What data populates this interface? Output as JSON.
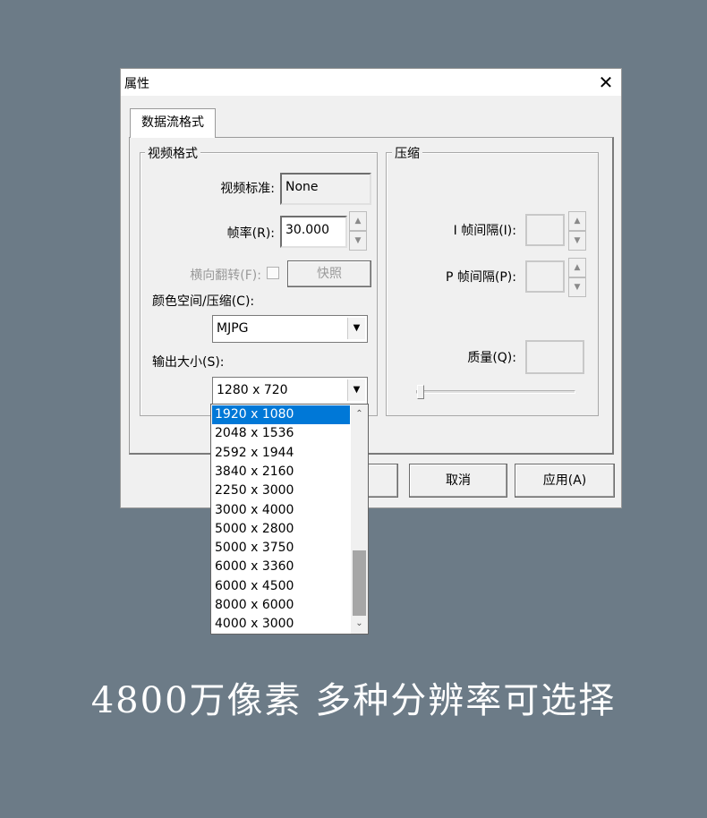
{
  "window": {
    "title": "属性",
    "close_glyph": "✕"
  },
  "tab": {
    "label": "数据流格式"
  },
  "video_group": {
    "title": "视频格式",
    "standard_label": "视频标准:",
    "standard_value": "None",
    "framerate_label": "帧率(R):",
    "framerate_value": "30.000",
    "flip_label": "横向翻转(F):",
    "snapshot_label": "快照",
    "colorspace_label": "颜色空间/压缩(C):",
    "colorspace_value": "MJPG",
    "output_label": "输出大小(S):",
    "output_value": "1280 x 720"
  },
  "compress_group": {
    "title": "压缩",
    "i_interval_label": "I 帧间隔(I):",
    "p_interval_label": "P 帧间隔(P):",
    "quality_label": "质量(Q):",
    "quality_slider_value": 0
  },
  "buttons": {
    "cancel": "取消",
    "apply": "应用(A)"
  },
  "dropdown": {
    "options": [
      "1920 x 1080",
      "2048 x 1536",
      "2592 x 1944",
      "3840 x 2160",
      "2250 x 3000",
      "3000 x 4000",
      "5000 x 2800",
      "5000 x 3750",
      "6000 x 3360",
      "6000 x 4500",
      "8000 x 6000",
      "4000 x 3000"
    ],
    "selected_index": 0,
    "selected_color": "#0078d7"
  },
  "caption": "4800万像素 多种分辨率可选择",
  "colors": {
    "background": "#6c7b87",
    "dialog": "#f0f0f0"
  },
  "icons": {
    "arrow_up": "▲",
    "arrow_down": "▼",
    "chevron_up": "⌃",
    "chevron_down": "⌄"
  }
}
